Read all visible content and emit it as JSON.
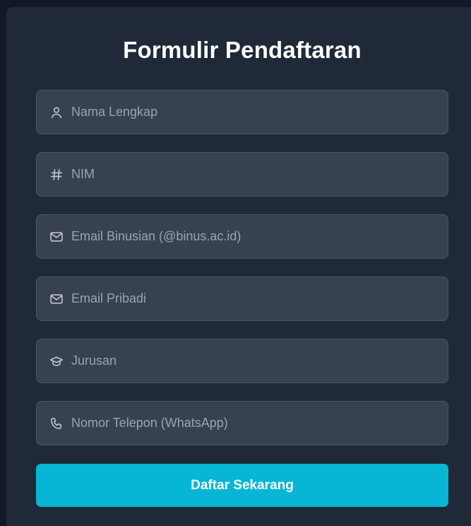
{
  "form": {
    "title": "Formulir Pendaftaran",
    "fields": [
      {
        "name": "nama",
        "placeholder": "Nama Lengkap",
        "icon": "user-icon",
        "value": ""
      },
      {
        "name": "nim",
        "placeholder": "NIM",
        "icon": "hash-icon",
        "value": ""
      },
      {
        "name": "email-binusian",
        "placeholder": "Email Binusian (@binus.ac.id)",
        "icon": "mail-icon",
        "value": ""
      },
      {
        "name": "email-pribadi",
        "placeholder": "Email Pribadi",
        "icon": "mail-icon",
        "value": ""
      },
      {
        "name": "jurusan",
        "placeholder": "Jurusan",
        "icon": "graduation-cap-icon",
        "value": ""
      },
      {
        "name": "telepon",
        "placeholder": "Nomor Telepon (WhatsApp)",
        "icon": "phone-icon",
        "value": ""
      }
    ],
    "submit_label": "Daftar Sekarang"
  },
  "colors": {
    "background": "#111827",
    "card": "#1f2937",
    "input": "#374151",
    "accent": "#06b6d4"
  }
}
